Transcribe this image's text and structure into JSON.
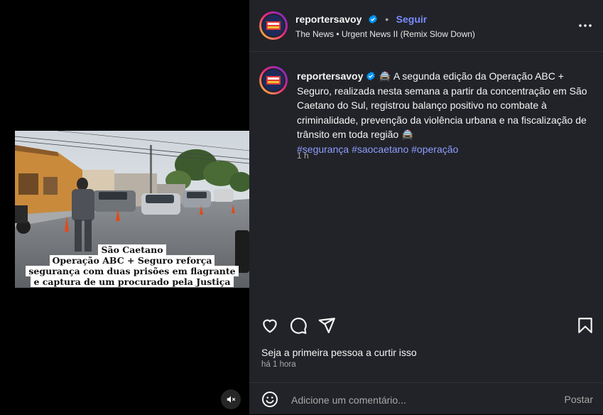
{
  "post": {
    "username": "reportersavoy",
    "follow_label": "Seguir",
    "separator": "•",
    "song": "The News • Urgent News II (Remix Slow Down)",
    "caption_text": " 🚔 A segunda edição da Operação ABC + Seguro, realizada nesta semana a partir da concentração em São Caetano do Sul, registrou balanço positivo no combate à criminalidade, prevenção da violência urbana e na fiscalização de trânsito em toda região 🚔",
    "hashtags": [
      "#segurança",
      "#saocaetano",
      "#operação"
    ],
    "caption_time": "1 h",
    "likes_text": "Seja a primeira pessoa a curtir isso",
    "date_text": "há 1 hora"
  },
  "media": {
    "overlay_lines": [
      "São Caetano",
      "Operação ABC + Seguro reforça",
      "segurança com duas prisões em flagrante",
      "e captura de um procurado pela Justiça"
    ]
  },
  "comment": {
    "placeholder": "Adicione um comentário...",
    "post_label": "Postar"
  },
  "icons": {
    "verified": "verified-badge-icon",
    "more": "more-options-icon",
    "like": "heart-icon",
    "comment": "comment-icon",
    "share": "share-icon",
    "save": "bookmark-icon",
    "emoji": "emoji-icon",
    "mute": "muted-speaker-icon"
  },
  "colors": {
    "panel_bg": "#212328",
    "accent": "#7a8bff",
    "hashtag": "#8f9cff",
    "verified": "#0095f6"
  }
}
